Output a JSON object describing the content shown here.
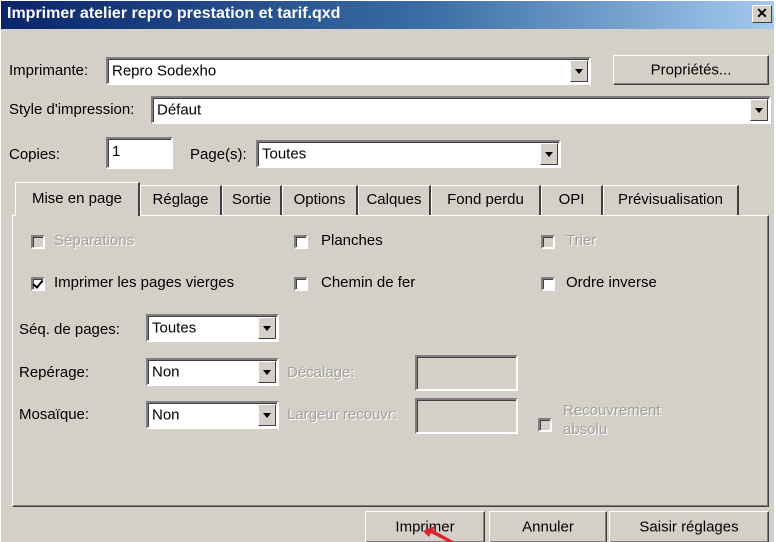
{
  "window": {
    "title": "Imprimer atelier repro prestation et tarif.qxd",
    "close_glyph": "✕"
  },
  "printer": {
    "label": "Imprimante:",
    "value": "Repro Sodexho",
    "properties_button": "Propriétés..."
  },
  "style": {
    "label": "Style d'impression:",
    "value": "Défaut"
  },
  "copies": {
    "label": "Copies:",
    "value": "1"
  },
  "pages": {
    "label": "Page(s):",
    "value": "Toutes"
  },
  "tabs": [
    {
      "label": "Mise en page",
      "active": true
    },
    {
      "label": "Réglage"
    },
    {
      "label": "Sortie"
    },
    {
      "label": "Options"
    },
    {
      "label": "Calques"
    },
    {
      "label": "Fond perdu"
    },
    {
      "label": "OPI"
    },
    {
      "label": "Prévisualisation"
    }
  ],
  "layout": {
    "separations": {
      "label": "Séparations",
      "checked": false,
      "enabled": false
    },
    "planches": {
      "label": "Planches",
      "checked": false,
      "enabled": true
    },
    "trier": {
      "label": "Trier",
      "checked": false,
      "enabled": false
    },
    "blank_pages": {
      "label": "Imprimer les pages vierges",
      "checked": true,
      "enabled": true
    },
    "chemin_de_fer": {
      "label": "Chemin de fer",
      "checked": false,
      "enabled": true
    },
    "ordre_inverse": {
      "label": "Ordre inverse",
      "checked": false,
      "enabled": true
    },
    "page_sequence": {
      "label": "Séq. de pages:",
      "value": "Toutes"
    },
    "reperage": {
      "label": "Repérage:",
      "value": "Non"
    },
    "decalage": {
      "label": "Décalage:",
      "value": ""
    },
    "mosaique": {
      "label": "Mosaïque:",
      "value": "Non"
    },
    "largeur_recouvr": {
      "label": "Largeur recouvr:",
      "value": ""
    },
    "recouvrement_absolu": {
      "label_line1": "Recouvrement",
      "label_line2": "absolu",
      "checked": false,
      "enabled": false
    }
  },
  "buttons": {
    "print": "Imprimer",
    "cancel": "Annuler",
    "capture": "Saisir réglages"
  },
  "colors": {
    "titlebar_start": "#0a246a",
    "titlebar_end": "#a6caf0",
    "dialog_face": "#d4d0c8",
    "pointer": "#e0202a"
  },
  "icons": {
    "combo_arrow": "chevron-down-icon",
    "close": "close-icon",
    "pointer": "mouse-pointer-icon"
  }
}
